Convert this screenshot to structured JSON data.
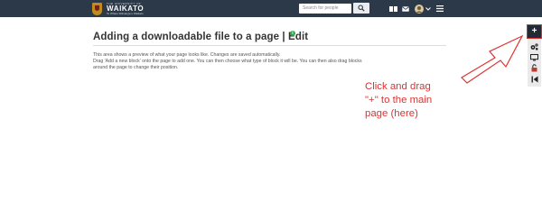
{
  "header": {
    "logo": {
      "small_text": "THE UNIVERSITY OF",
      "name": "WAIKATO",
      "tagline": "Te Whare Wānanga o Waikato"
    },
    "search_placeholder": "Search for people",
    "icons": [
      "search-icon",
      "apps-icon",
      "mail-icon",
      "avatar",
      "chevron-down-icon",
      "menu-icon"
    ]
  },
  "page": {
    "title": "Adding a downloadable file to a page | Edit",
    "info_badge": "i",
    "description": [
      "This area shows a preview of what your page looks like. Changes are saved automatically.",
      "Drag 'Add a new block' onto the page to add one. You can then choose what type of block it will be. You can then also drag blocks",
      "around the page to change their position."
    ]
  },
  "annotation": {
    "lines": [
      "Click and drag",
      "\"+\" to the main",
      "page (here)"
    ],
    "color": "#e03131"
  },
  "toolbar": {
    "add_label": "+",
    "items": [
      "settings-icon",
      "display-icon",
      "lock-icon",
      "return-icon"
    ]
  }
}
